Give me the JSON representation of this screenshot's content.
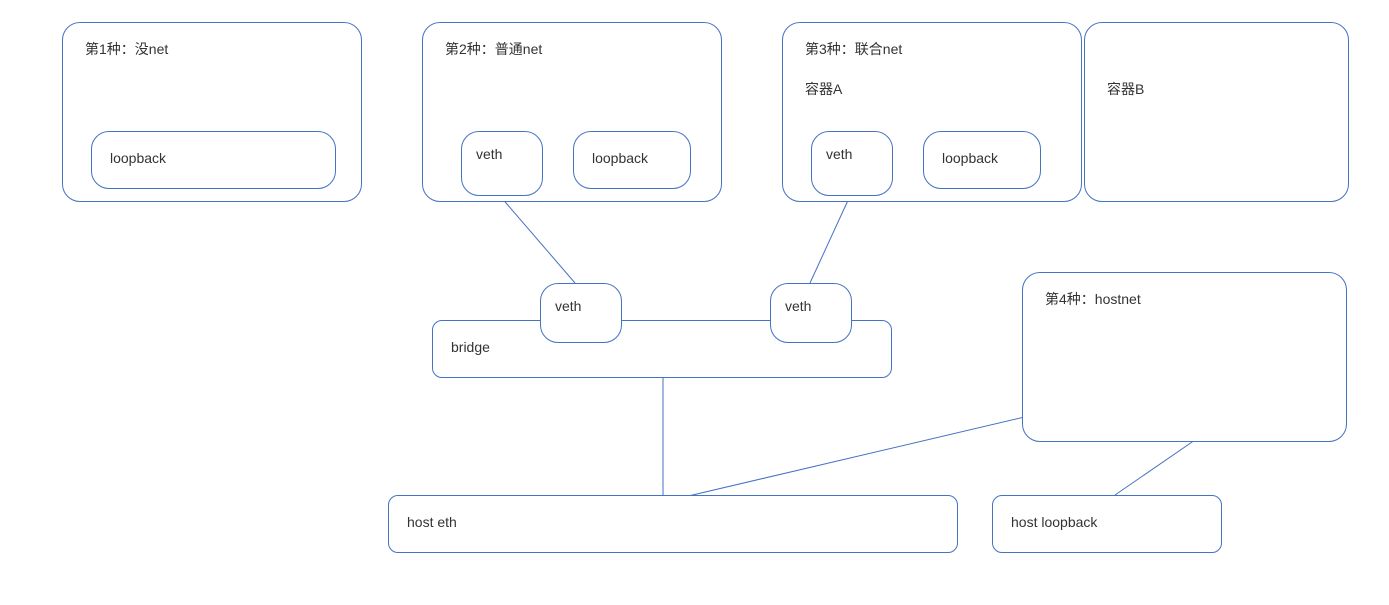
{
  "type1": {
    "title": "第1种：没net",
    "loopback": "loopback"
  },
  "type2": {
    "title": "第2种：普通net",
    "veth": "veth",
    "loopback": "loopback"
  },
  "type3": {
    "title": "第3种：联合net",
    "containerA": "容器A",
    "containerB": "容器B",
    "veth": "veth",
    "loopback": "loopback"
  },
  "type4": {
    "title": "第4种：hostnet"
  },
  "bridge": {
    "label": "bridge",
    "veth_left": "veth",
    "veth_right": "veth"
  },
  "host": {
    "eth": "host eth",
    "loopback": "host loopback"
  }
}
